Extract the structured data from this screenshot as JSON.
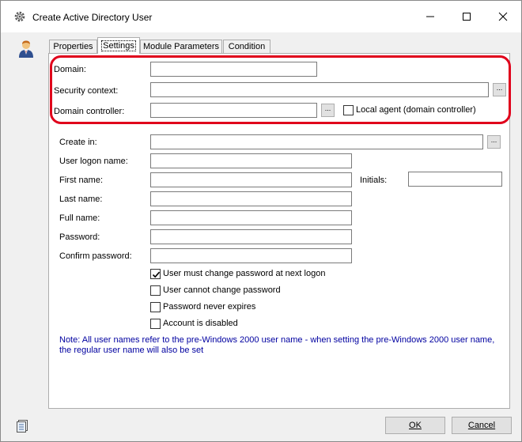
{
  "window": {
    "title": "Create Active Directory User"
  },
  "tabs": [
    {
      "label": "Properties"
    },
    {
      "label": "Settings"
    },
    {
      "label": "Module Parameters"
    },
    {
      "label": "Condition"
    }
  ],
  "settings": {
    "domain_label": "Domain:",
    "security_context_label": "Security context:",
    "domain_controller_label": "Domain controller:",
    "local_agent_label": "Local agent (domain controller)",
    "browse_label": "...",
    "create_in_label": "Create in:",
    "user_logon_label": "User logon name:",
    "first_name_label": "First name:",
    "initials_label": "Initials:",
    "last_name_label": "Last name:",
    "full_name_label": "Full name:",
    "password_label": "Password:",
    "confirm_password_label": "Confirm password:",
    "values": {
      "domain": "",
      "security_context": "",
      "domain_controller": "",
      "create_in": "",
      "user_logon": "",
      "first_name": "",
      "initials": "",
      "last_name": "",
      "full_name": "",
      "password": "",
      "confirm_password": ""
    },
    "options": [
      {
        "label": "User must change password at next logon",
        "checked": true
      },
      {
        "label": "User cannot change password",
        "checked": false
      },
      {
        "label": "Password never expires",
        "checked": false
      },
      {
        "label": "Account is disabled",
        "checked": false
      }
    ],
    "note_line1": "Note: All user names refer to the pre-Windows 2000 user name - when setting the pre-Windows 2000 user name,",
    "note_line2": "the regular user name will also be set"
  },
  "buttons": {
    "ok_label": "OK",
    "cancel_label": "Cancel"
  },
  "colors": {
    "highlight": "#e0001b",
    "note": "#0000a0"
  },
  "icons": [
    "gear-icon",
    "user-avatar-icon",
    "minimize-icon",
    "maximize-icon",
    "close-icon",
    "list-icon",
    "checkmark-icon"
  ]
}
